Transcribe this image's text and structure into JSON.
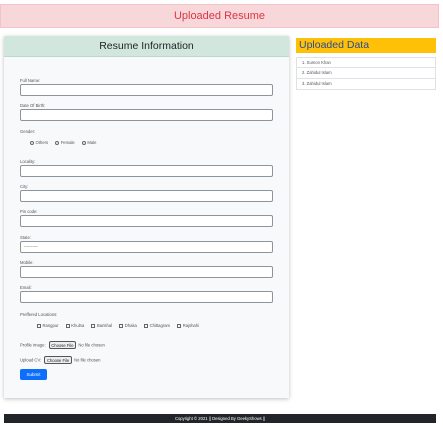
{
  "banner": {
    "title": "Uploaded Resume"
  },
  "form": {
    "title": "Resume Information",
    "full_name_label": "Full Name:",
    "dob_label": "Date Of Birth:",
    "gender_label": "Gender:",
    "gender_options": [
      "Others",
      "Female",
      "Male"
    ],
    "locality_label": "Locality:",
    "city_label": "City:",
    "pin_label": "Pin code:",
    "state_label": "State:",
    "state_value": "----------",
    "mobile_label": "Mobile:",
    "email_label": "Email:",
    "locations_label": "Preffered Locations:",
    "locations": [
      "Rangpur",
      "Khulna",
      "Barishal",
      "Dhaka",
      "Chittagram",
      "Rajshahi"
    ],
    "profile_label": "Profile image:",
    "cv_label": "Upload CV:",
    "choose_file": "Choose File",
    "no_file": "No file chosen",
    "submit_label": "Submit"
  },
  "uploaded": {
    "title": "Uploaded Data",
    "items": [
      "1. Sumon Khan",
      "2. Zahidul Islam",
      "3. Zahidul Islam"
    ]
  },
  "footer": {
    "text": "Copyright © 2021 || Designed By GeekyShows ||"
  },
  "colors": {
    "banner_bg": "#f8d7da",
    "banner_text": "#dc3545",
    "form_head_bg": "#d1e7dd",
    "side_head_bg": "#ffc107",
    "submit_bg": "#0d6efd",
    "footer_bg": "#212529"
  }
}
